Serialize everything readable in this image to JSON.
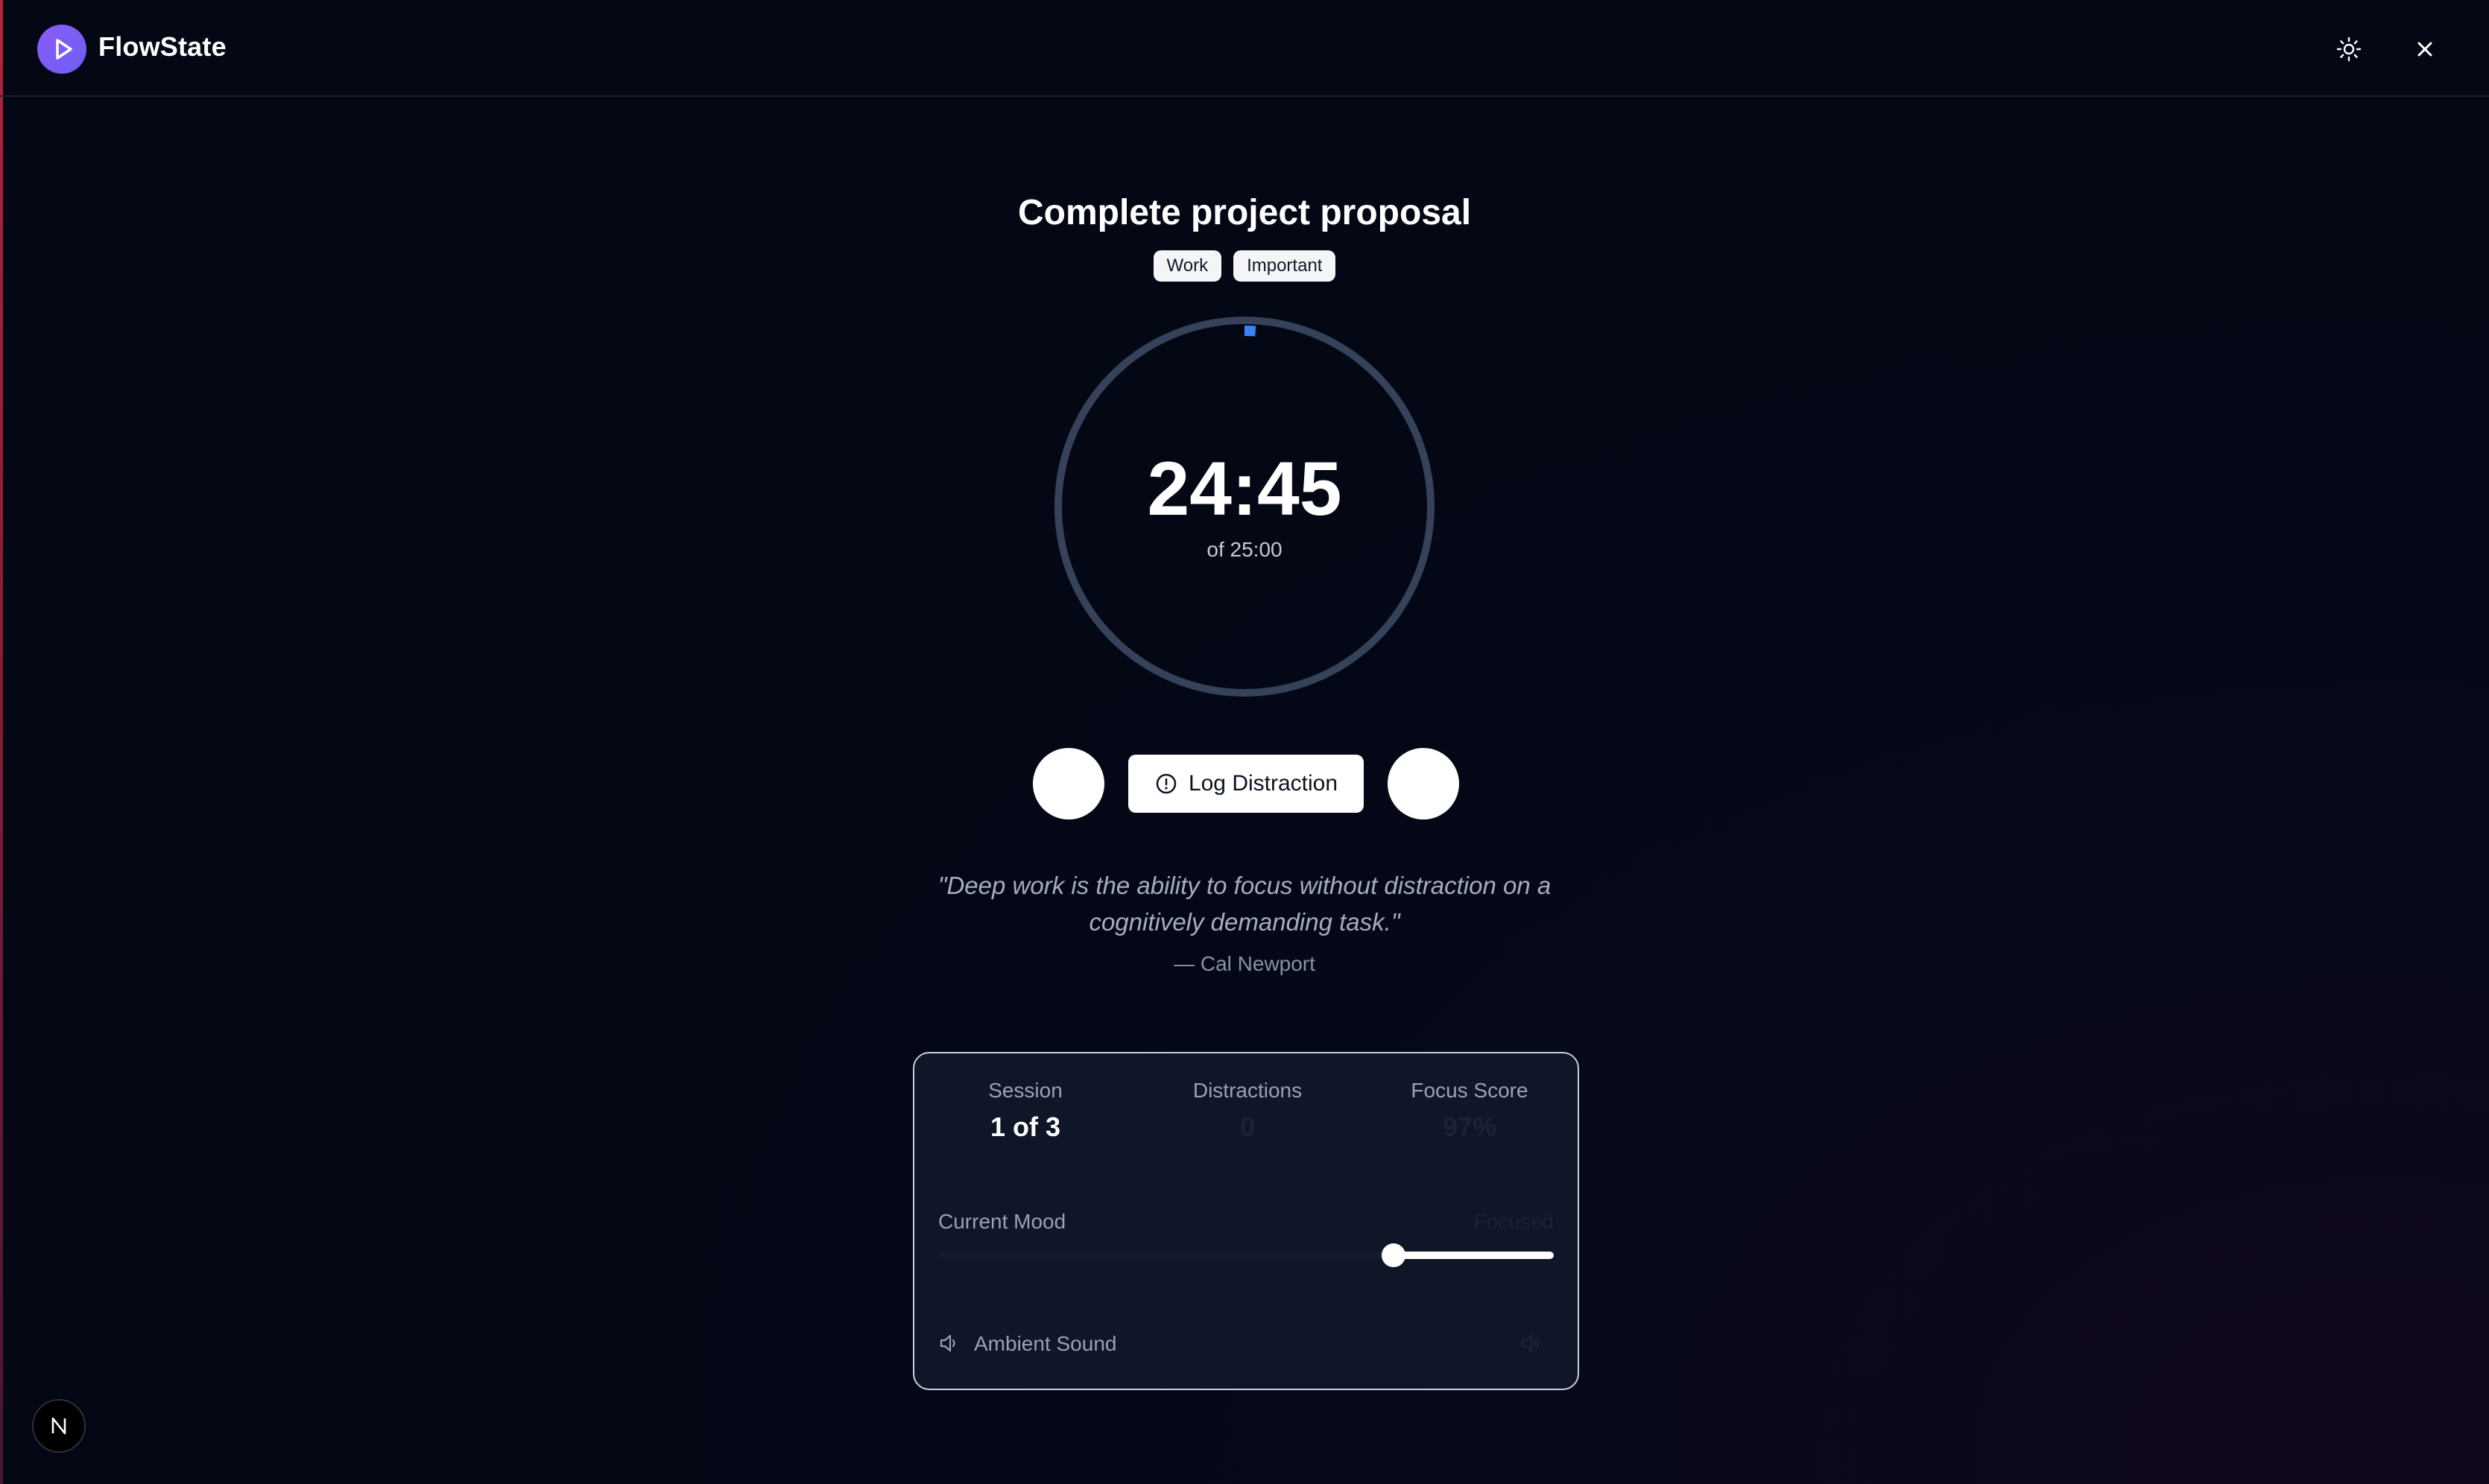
{
  "app": {
    "name": "FlowState"
  },
  "header": {
    "logo_icon": "play-icon",
    "theme_icon": "sun-icon",
    "close_icon": "close-icon"
  },
  "task": {
    "title": "Complete project proposal",
    "tags": [
      "Work",
      "Important"
    ]
  },
  "timer": {
    "remaining": "24:45",
    "total_label": "of 25:00",
    "progress_fraction": 0.01
  },
  "controls": {
    "log_label": "Log Distraction",
    "log_icon": "alert-circle-icon"
  },
  "quote": {
    "text": "\"Deep work is the ability to focus without distraction on a cognitively demanding task.\"",
    "author": "— Cal Newport"
  },
  "stats": {
    "session_label": "Session",
    "session_value": "1 of 3",
    "distractions_label": "Distractions",
    "distractions_value": "0",
    "focus_label": "Focus Score",
    "focus_value": "97%"
  },
  "mood": {
    "label": "Current Mood",
    "value_label": "Focused",
    "level": 0.74
  },
  "sound": {
    "label": "Ambient Sound",
    "icon": "volume-icon"
  },
  "colors": {
    "accent": "#3b82f6",
    "ring": "#354259",
    "logo": "#8b5cf6"
  }
}
